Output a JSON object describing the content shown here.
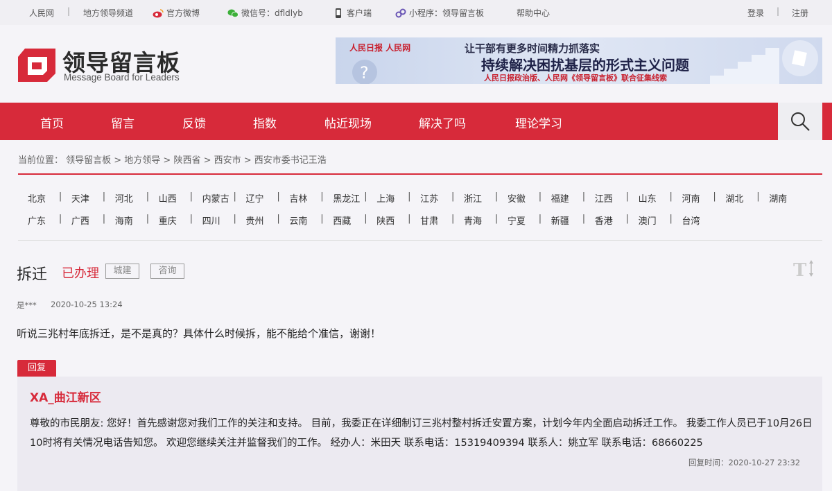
{
  "topbar": {
    "people": "人民网",
    "channel": "地方领导频道",
    "weibo": "官方微博",
    "wechat": "微信号：dfldlyb",
    "client": "客户端",
    "miniprogram": "小程序：领导留言板",
    "help": "帮助中心",
    "login": "登录",
    "register": "注册",
    "sep": "|"
  },
  "logo": {
    "cn": "领导留言板",
    "en": "Message Board for Leaders"
  },
  "banner": {
    "left": "人民日报  人民网",
    "line1": "让干部有更多时间精力抓落实",
    "line2": "持续解决困扰基层的形式主义问题",
    "line3": "人民日报政治版、人民网《领导留言板》联合征集线索"
  },
  "nav": [
    "首页",
    "留言",
    "反馈",
    "指数",
    "帖近现场",
    "解决了吗",
    "理论学习"
  ],
  "breadcrumb": "当前位置： 领导留言板 > 地方领导 > 陕西省 > 西安市 > 西安市委书记王浩",
  "provinces_row1": [
    "北京",
    "天津",
    "河北",
    "山西",
    "内蒙古",
    "辽宁",
    "吉林",
    "黑龙江",
    "上海",
    "江苏",
    "浙江",
    "安徽",
    "福建",
    "江西",
    "山东",
    "河南",
    "湖北",
    "湖南"
  ],
  "provinces_row2": [
    "广东",
    "广西",
    "海南",
    "重庆",
    "四川",
    "贵州",
    "云南",
    "西藏",
    "陕西",
    "甘肃",
    "青海",
    "宁夏",
    "新疆",
    "香港",
    "澳门",
    "台湾"
  ],
  "message": {
    "title": "拆迁",
    "status": "已办理",
    "tags": [
      "城建",
      "咨询"
    ],
    "author": "是***",
    "time": "2020-10-25 13:24",
    "content": "听说三兆村年底拆迁，是不是真的？具体什么时候拆，能不能给个准信，谢谢！"
  },
  "reply": {
    "label": "回复",
    "org": "XA_曲江新区",
    "body": "尊敬的市民朋友: 您好！首先感谢您对我们工作的关注和支持。 目前，我委正在详细制订三兆村整村拆迁安置方案，计划今年内全面启动拆迁工作。 我委工作人员已于10月26日10时将有关情况电话告知您。 欢迎您继续关注并监督我们的工作。 经办人：米田天 联系电话：15319409394 联系人：姚立军 联系电话：68660225",
    "time": "回复时间：2020-10-27 23:32"
  },
  "colors": {
    "brand_red": "#d72a3a",
    "background": "#f5f4f8"
  }
}
